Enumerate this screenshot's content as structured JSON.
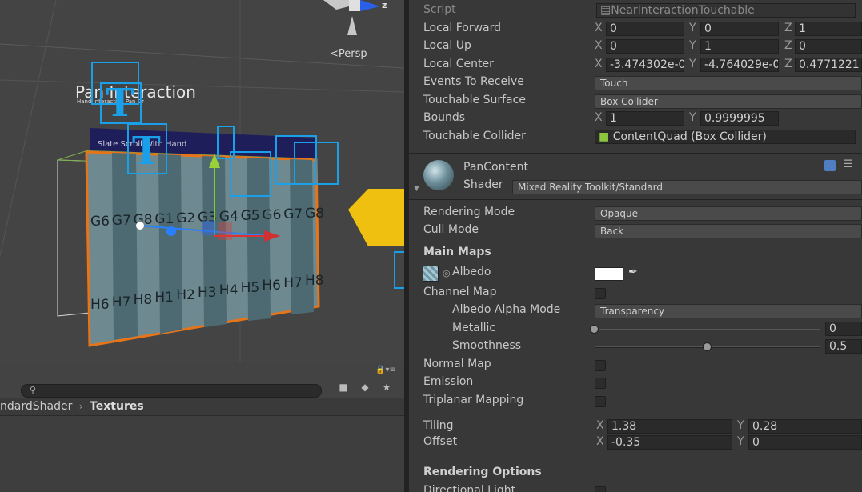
{
  "scene": {
    "persp_label": "<Persp",
    "gizmo_axis": "z",
    "title": "Pan Interaction",
    "subtitle": "Hand Interaction Pan Gr",
    "slate_label": "Slate Scroll With Hand",
    "grid_top": [
      "G6",
      "G7",
      "G8",
      "G1",
      "G2",
      "G3",
      "G4",
      "G5",
      "G6",
      "G7",
      "G8"
    ],
    "grid_bottom": [
      "H6",
      "H7",
      "H8",
      "H1",
      "H2",
      "H3",
      "H4",
      "H5",
      "H6",
      "H7",
      "H8"
    ]
  },
  "project": {
    "breadcrumb_parent": "ndardShader",
    "breadcrumb_current": "Textures"
  },
  "inspector": {
    "script": {
      "label": "Script",
      "value": "NearInteractionTouchable"
    },
    "local_forward": {
      "label": "Local Forward",
      "x": "0",
      "y": "0",
      "z": "1"
    },
    "local_up": {
      "label": "Local Up",
      "x": "0",
      "y": "1",
      "z": "0"
    },
    "local_center": {
      "label": "Local Center",
      "x": "-3.474302e-0",
      "y": "-4.764029e-0",
      "z": "0.4771221"
    },
    "events": {
      "label": "Events To Receive",
      "value": "Touch"
    },
    "surface": {
      "label": "Touchable Surface",
      "value": "Box Collider"
    },
    "bounds": {
      "label": "Bounds",
      "x": "1",
      "y": "0.9999995"
    },
    "collider": {
      "label": "Touchable Collider",
      "value": "ContentQuad (Box Collider)"
    },
    "material": {
      "name": "PanContent",
      "shader_label": "Shader",
      "shader_value": "Mixed Reality Toolkit/Standard"
    },
    "rendering_mode": {
      "label": "Rendering Mode",
      "value": "Opaque"
    },
    "cull_mode": {
      "label": "Cull Mode",
      "value": "Back"
    },
    "main_maps": "Main Maps",
    "albedo": "Albedo",
    "channel_map": "Channel Map",
    "albedo_alpha": {
      "label": "Albedo Alpha Mode",
      "value": "Transparency"
    },
    "metallic": {
      "label": "Metallic",
      "value": "0",
      "fraction": 0
    },
    "smoothness": {
      "label": "Smoothness",
      "value": "0.5",
      "fraction": 0.5
    },
    "normal_map": "Normal Map",
    "emission": "Emission",
    "triplanar": "Triplanar Mapping",
    "tiling": {
      "label": "Tiling",
      "x": "1.38",
      "y": "0.28"
    },
    "offset": {
      "label": "Offset",
      "x": "-0.35",
      "y": "0"
    },
    "rendering_options": "Rendering Options",
    "directional_light": "Directional Light",
    "axis_x": "X",
    "axis_y": "Y",
    "axis_z": "Z"
  }
}
